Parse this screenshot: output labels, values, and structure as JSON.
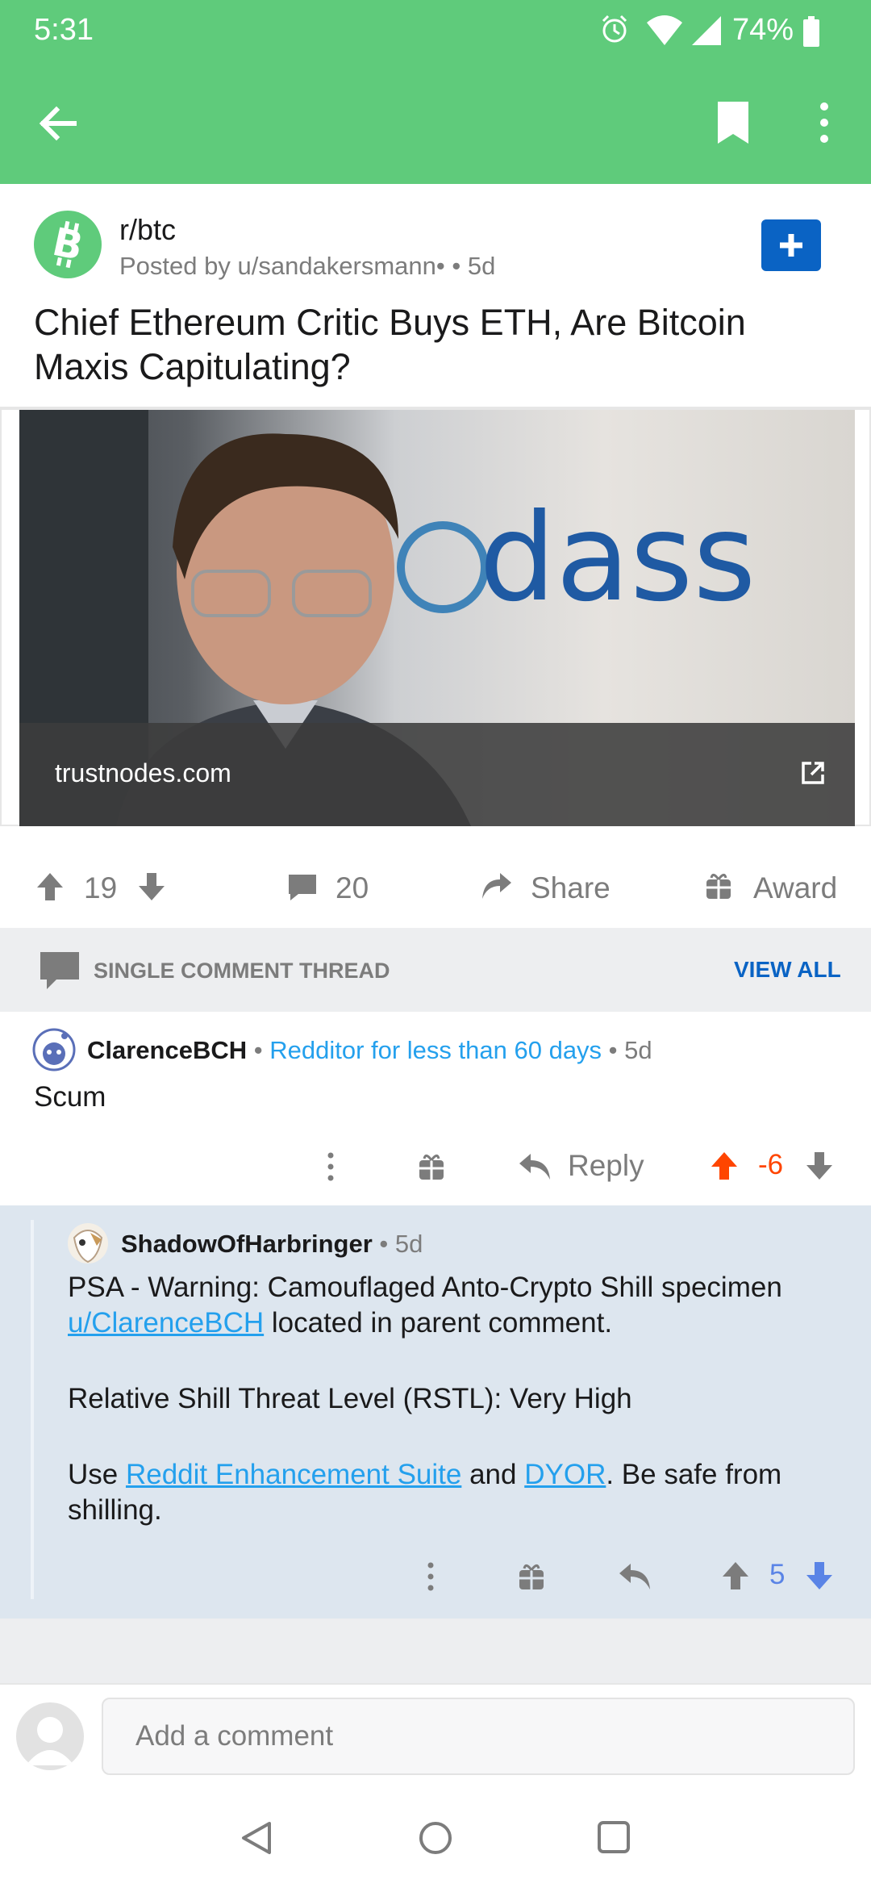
{
  "status_bar": {
    "time": "5:31",
    "battery": "74%"
  },
  "app_bar": {
    "back_icon": "back-arrow-icon",
    "save_icon": "bookmark-icon",
    "more_icon": "more-vertical-icon"
  },
  "post": {
    "subreddit": "r/btc",
    "posted_by": "Posted by u/sandakersmann•",
    "age": "• 5d",
    "title": "Chief Ethereum Critic Buys ETH, Are Bitcoin Maxis Capitulating?",
    "link_domain": "trustnodes.com",
    "image_sign_text": "dass",
    "upvotes": "19",
    "comments": "20",
    "share_label": "Share",
    "award_label": "Award"
  },
  "thread": {
    "label": "SINGLE COMMENT THREAD",
    "view_all": "VIEW ALL"
  },
  "comments": [
    {
      "author": "ClarenceBCH",
      "sep1": " • ",
      "flair": "Redditor for less than 60 days",
      "sep2": " • ",
      "age": "5d",
      "body": "Scum",
      "reply_label": "Reply",
      "score": "-6",
      "score_color": "#ff4500"
    },
    {
      "author": "ShadowOfHarbringer",
      "sep": " • ",
      "age": "5d",
      "p1_text": "PSA - Warning: Camouflaged Anto-Crypto Shill specimen ",
      "p1_link": "u/ClarenceBCH",
      "p1_tail": " located in parent comment.",
      "p2_text": "Relative Shill Threat Level (RSTL): Very High",
      "p3_pre": "Use ",
      "p3_link1": "Reddit Enhancement Suite",
      "p3_mid": " and ",
      "p3_link2": "DYOR",
      "p3_tail": ". Be safe from shilling.",
      "score": "5",
      "score_color": "#5a84e6"
    }
  ],
  "comment_box": {
    "placeholder": "Add a comment"
  },
  "colors": {
    "brand_green": "#5fcb7b",
    "link_blue": "#24a0ed",
    "button_blue": "#0a63c4",
    "upvote_orange": "#ff4500"
  }
}
